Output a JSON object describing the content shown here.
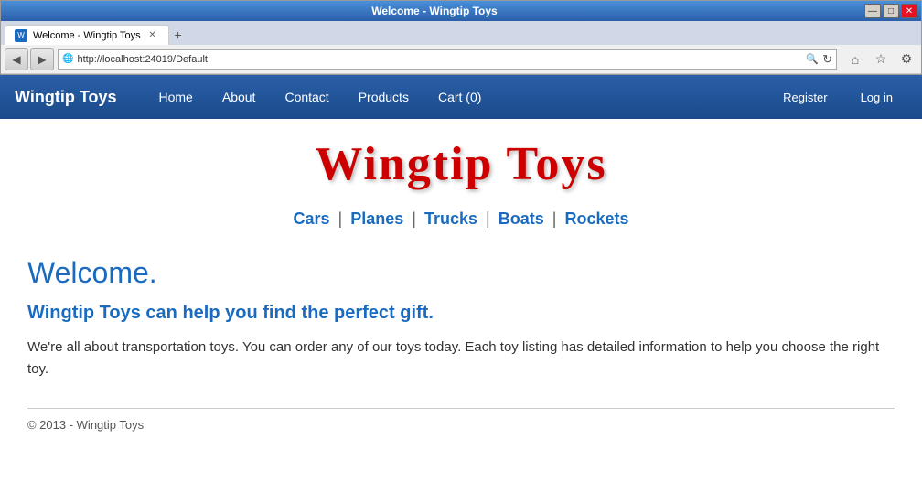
{
  "window": {
    "title": "Welcome - Wingtip Toys",
    "controls": {
      "minimize": "—",
      "maximize": "□",
      "close": "✕"
    }
  },
  "browser": {
    "address": "http://localhost:24019/Default",
    "tab_label": "Welcome - Wingtip Toys",
    "icons": {
      "back": "◀",
      "forward": "▶",
      "search": "🔍",
      "refresh": "↻",
      "home": "⌂",
      "star": "☆",
      "settings": "⚙"
    }
  },
  "navbar": {
    "brand": "Wingtip Toys",
    "links": [
      {
        "label": "Home"
      },
      {
        "label": "About"
      },
      {
        "label": "Contact"
      },
      {
        "label": "Products"
      },
      {
        "label": "Cart (0)"
      }
    ],
    "right_links": [
      {
        "label": "Register"
      },
      {
        "label": "Log in"
      }
    ]
  },
  "main": {
    "site_title": "Wingtip Toys",
    "categories": [
      {
        "label": "Cars"
      },
      {
        "label": "Planes"
      },
      {
        "label": "Trucks"
      },
      {
        "label": "Boats"
      },
      {
        "label": "Rockets"
      }
    ],
    "welcome_heading": "Welcome.",
    "welcome_subheading": "Wingtip Toys can help you find the perfect gift.",
    "welcome_text": "We're all about transportation toys. You can order any of our toys today. Each toy listing has detailed information to help you choose the right toy.",
    "footer": "© 2013 - Wingtip Toys"
  }
}
